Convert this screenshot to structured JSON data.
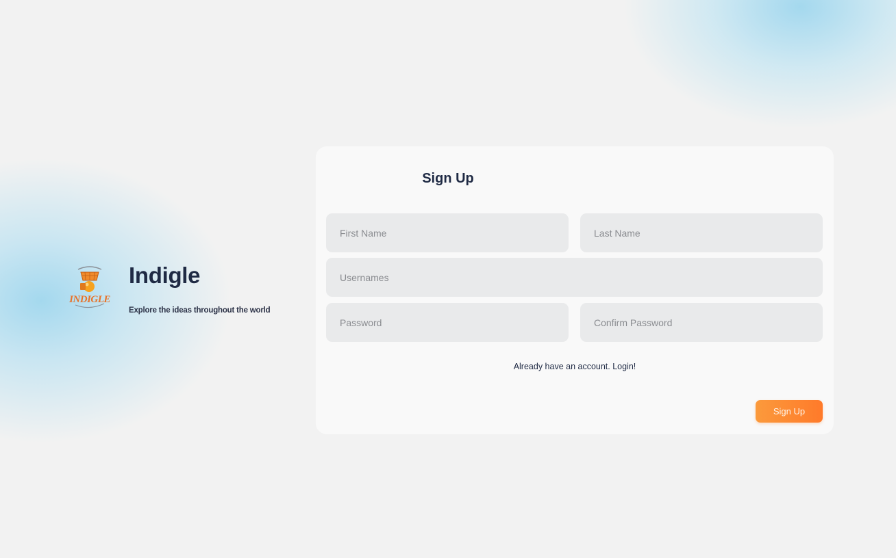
{
  "brand": {
    "name": "Indigle",
    "tagline": "Explore the ideas throughout the world",
    "logo_text": "INDIGLE",
    "logo_icon": "cart-logo-icon"
  },
  "form": {
    "title": "Sign Up",
    "first_name_placeholder": "First Name",
    "last_name_placeholder": "Last Name",
    "username_placeholder": "Usernames",
    "password_placeholder": "Password",
    "confirm_password_placeholder": "Confirm Password",
    "login_link": "Already have an account. Login!",
    "submit_label": "Sign Up"
  },
  "colors": {
    "accent": "#ff8a30",
    "text_dark": "#1f2a44",
    "background": "#f2f2f2",
    "field_bg": "#e9eaeb"
  }
}
